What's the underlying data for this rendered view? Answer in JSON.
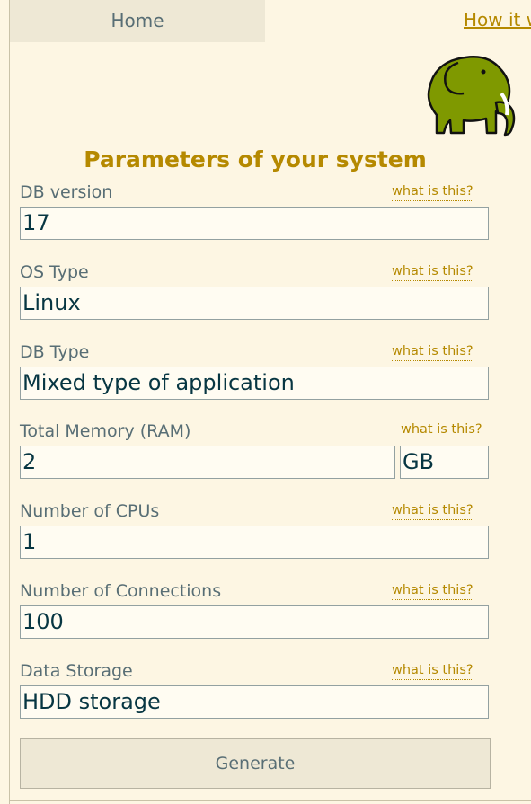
{
  "nav": {
    "home_label": "Home",
    "how_label": "How it w"
  },
  "logo": {
    "icon": "elephant-icon",
    "color": "#7f9900"
  },
  "form": {
    "title": "Parameters of your system",
    "help_text": "what is this?",
    "db_version": {
      "label": "DB version",
      "value": "17"
    },
    "os_type": {
      "label": "OS Type",
      "value": "Linux"
    },
    "db_type": {
      "label": "DB Type",
      "value": "Mixed type of application"
    },
    "total_memory": {
      "label": "Total Memory (RAM)",
      "value": "2",
      "unit": "GB"
    },
    "cpus": {
      "label": "Number of CPUs",
      "value": "1"
    },
    "connections": {
      "label": "Number of Connections",
      "value": "100"
    },
    "storage": {
      "label": "Data Storage",
      "value": "HDD storage"
    },
    "generate_label": "Generate"
  },
  "colors": {
    "background": "#fdf6e3",
    "accent": "#b58900",
    "label": "#586e75"
  }
}
